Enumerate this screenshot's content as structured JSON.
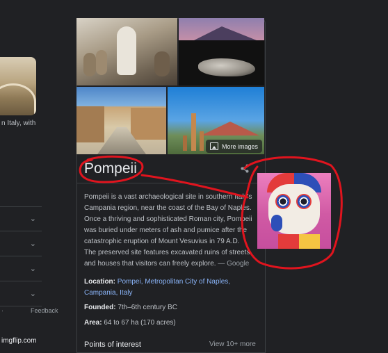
{
  "left": {
    "snippet_text": "n Italy, with",
    "feedback": "Feedback",
    "rows": [
      {
        "chevron": "chevron-down-icon"
      },
      {
        "chevron": "chevron-down-icon"
      },
      {
        "chevron": "chevron-down-icon"
      },
      {
        "chevron": "chevron-down-icon"
      }
    ]
  },
  "panel": {
    "more_images": "More images",
    "title": "Pompeii",
    "share_icon": "share-icon",
    "description": "Pompeii is a vast archaeological site in southern Italy's\nCampania region, near the coast of the Bay of Naples.\nOnce a thriving and sophisticated Roman city, Pompeii\nwas buried under meters of ash and pumice after the\ncatastrophic eruption of Mount Vesuvius in 79 A.D.\nThe preserved site features excavated ruins of streets\nand houses that visitors can freely explore.",
    "description_source": " — Google",
    "facts": {
      "location_label": "Location:",
      "location_value": "Pompei, Metropolitan City of Naples, Campania, Italy",
      "founded_label": "Founded:",
      "founded_value": "7th–6th century BC",
      "area_label": "Area:",
      "area_value": "64 to 67 ha (170 acres)"
    },
    "points_of_interest": "Points of interest",
    "view_more": "View 10+ more"
  },
  "watermark": "imgflip.com",
  "colors": {
    "background": "#202124",
    "link": "#8ab4f8",
    "annotation_red": "#e0141e"
  }
}
